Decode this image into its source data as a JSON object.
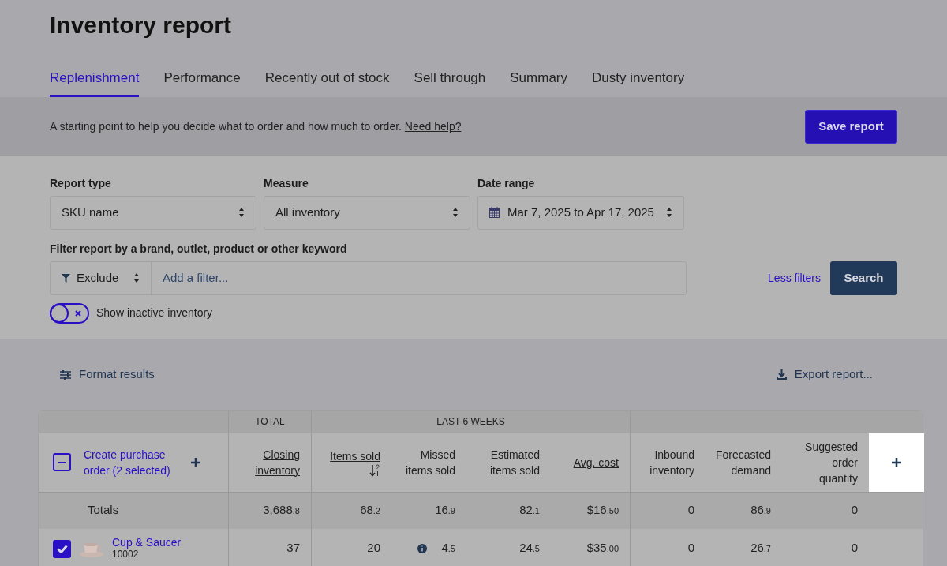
{
  "title": "Inventory report",
  "tabs": [
    {
      "label": "Replenishment",
      "selected": true
    },
    {
      "label": "Performance",
      "selected": false
    },
    {
      "label": "Recently out of stock",
      "selected": false
    },
    {
      "label": "Sell through",
      "selected": false
    },
    {
      "label": "Summary",
      "selected": false
    },
    {
      "label": "Dusty inventory",
      "selected": false
    }
  ],
  "description": {
    "text": "A starting point to help you decide what to order and how much to order.",
    "link": "Need help?"
  },
  "save_button": "Save report",
  "filters": {
    "selects": [
      {
        "label": "Report type",
        "value": "SKU name",
        "kind": "plain"
      },
      {
        "label": "Measure",
        "value": "All inventory",
        "kind": "plain"
      },
      {
        "label": "Date range",
        "value": "Mar 7, 2025 to Apr 17, 2025",
        "kind": "date"
      }
    ],
    "keyword_label": "Filter report by a brand, outlet, product or other keyword",
    "mode": "Exclude",
    "placeholder": "Add a filter...",
    "less_filters": "Less filters",
    "search_button": "Search",
    "toggle": {
      "label": "Show inactive inventory",
      "on": false
    }
  },
  "format_results": "Format results",
  "export_report": "Export report...",
  "table": {
    "group_headings": [
      "TOTAL",
      "LAST 6 WEEKS"
    ],
    "select_all": {
      "indeterminate": true,
      "label": "Create purchase order (2 selected)"
    },
    "columns": [
      {
        "label": "Closing inventory",
        "underlined": true,
        "sorted": false
      },
      {
        "label": "Items sold",
        "underlined": true,
        "sorted": true
      },
      {
        "label": "Missed items sold",
        "underlined": false,
        "sorted": false
      },
      {
        "label": "Estimated items sold",
        "underlined": false,
        "sorted": false
      },
      {
        "label": "Avg. cost",
        "underlined": true,
        "sorted": false
      },
      {
        "label": "Inbound inventory",
        "underlined": false,
        "sorted": false
      },
      {
        "label": "Forecasted demand",
        "underlined": false,
        "sorted": false
      },
      {
        "label": "Suggested order quantity",
        "underlined": false,
        "sorted": false
      }
    ],
    "totals": {
      "label": "Totals",
      "cells": [
        {
          "main": "3,688",
          "fraction": ".8"
        },
        {
          "main": "68",
          "fraction": ".2"
        },
        {
          "main": "16",
          "fraction": ".9"
        },
        {
          "main": "82",
          "fraction": ".1"
        },
        {
          "main": "$16",
          "fraction": ".50"
        },
        {
          "main": "0"
        },
        {
          "main": "86",
          "fraction": ".9"
        },
        {
          "main": "0"
        }
      ]
    },
    "rows": [
      {
        "checked": true,
        "name": "Cup & Saucer",
        "sku": "10002",
        "cells": [
          {
            "main": "37",
            "info": false
          },
          {
            "main": "20",
            "info": false
          },
          {
            "main": "4",
            "fraction": ".5",
            "info": true
          },
          {
            "main": "24",
            "fraction": ".5",
            "info": false
          },
          {
            "main": "$35",
            "fraction": ".00",
            "info": false
          },
          {
            "main": "0",
            "info": false
          },
          {
            "main": "26",
            "fraction": ".7",
            "info": false
          },
          {
            "main": "0",
            "info": false
          }
        ]
      }
    ]
  }
}
